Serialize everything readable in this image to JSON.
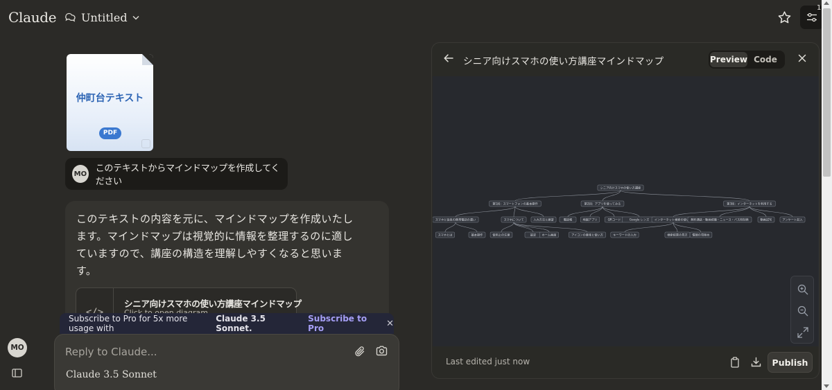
{
  "app": {
    "logo": "Claude"
  },
  "header": {
    "title": "Untitled",
    "settings_count": "1"
  },
  "attachment": {
    "name": "仲町台テキスト",
    "type": "PDF"
  },
  "user_message": {
    "avatar": "MO",
    "text": "このテキストからマインドマップを作成してください"
  },
  "assistant_message": {
    "text": "このテキストの内容を元に、マインドマップを作成いたします。マインドマップは視覚的に情報を整理するのに適していますので、講座の構造を理解しやすくなると思います。",
    "artifact": {
      "title": "シニア向けスマホの使い方講座マインドマップ",
      "subtitle": "Click to open diagram"
    }
  },
  "pro_banner": {
    "text": "Subscribe to Pro for 5x more usage with",
    "model": "Claude 3.5 Sonnet.",
    "link": "Subscribe to Pro"
  },
  "composer": {
    "placeholder": "Reply to Claude...",
    "model": "Claude 3.5 Sonnet"
  },
  "rail": {
    "avatar": "MO"
  },
  "panel": {
    "title": "シニア向けスマホの使い方講座マインドマップ",
    "tab_preview": "Preview",
    "tab_code": "Code",
    "active_tab": "Preview",
    "footer_status": "Last edited just now",
    "publish": "Publish"
  },
  "mindmap": {
    "root": "シニア向けスマホの使い方講座",
    "branches": [
      {
        "label": "第1回：スマートフォンの基本操作",
        "children": [
          {
            "label": "スマホと従来の携帯電話の違い",
            "children": [
              "スマホとは",
              "基本操作"
            ]
          },
          {
            "label": "スマホについて",
            "children": [
              "使用上の注意",
              "設定",
              "ホーム画面",
              "アイコンの意味と使い方"
            ]
          },
          {
            "label": "入力方法と練習",
            "children": []
          }
        ]
      },
      {
        "label": "第2回：アプリを使ってみる",
        "children": [
          {
            "label": "電話帳",
            "children": []
          },
          {
            "label": "地図アプリ",
            "children": []
          },
          {
            "label": "QRコード",
            "children": []
          },
          {
            "label": "Google レンズ",
            "children": []
          }
        ]
      },
      {
        "label": "第3回：インターネットを利用する",
        "children": [
          {
            "label": "インターネット検索の使い方",
            "children": [
              "キーワードの入力",
              "検索結果の見方",
              "情報の見極め"
            ]
          },
          {
            "label": "無料通話・動画視聴・ニュース・バス時刻表",
            "children": []
          },
          {
            "label": "動画試写",
            "children": []
          },
          {
            "label": "アンケート記入",
            "children": []
          }
        ]
      }
    ]
  }
}
